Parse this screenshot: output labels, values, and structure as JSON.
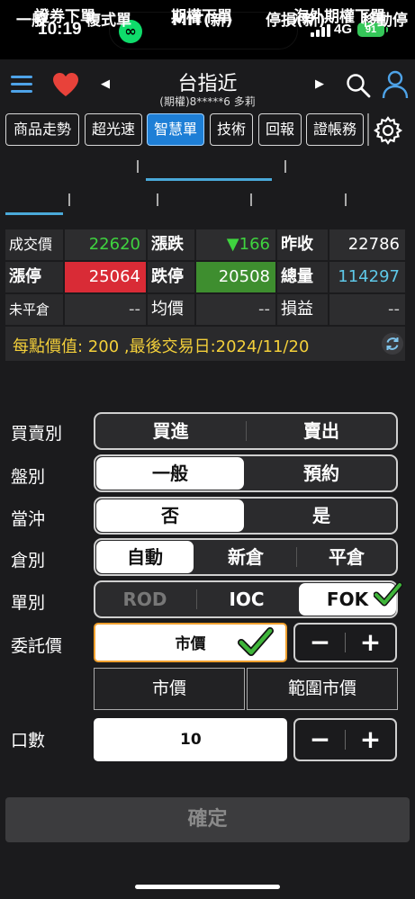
{
  "status_bar": {
    "time": "10:19",
    "network": "4G",
    "battery": "91"
  },
  "header": {
    "title": "台指近",
    "subtitle": "(期權)8*****6  多莉"
  },
  "func_buttons": [
    "商品走勢",
    "超光速",
    "智慧單",
    "技術",
    "回報",
    "證帳務"
  ],
  "tabs_primary": [
    "證券下單",
    "期權下單",
    "海外期權下單"
  ],
  "tabs_secondary": [
    "一般",
    "複式單",
    "MIT(新)",
    "停損(新)",
    "移動停"
  ],
  "quote": {
    "last_label": "成交價",
    "last_value": "22620",
    "change_label": "漲跌",
    "change_value": "▼166",
    "prev_close_label": "昨收",
    "prev_close_value": "22786",
    "limit_up_label": "漲停",
    "limit_up_value": "25064",
    "limit_down_label": "跌停",
    "limit_down_value": "20508",
    "volume_label": "總量",
    "volume_value": "114297",
    "open_pos_label": "未平倉",
    "open_pos_value": "--",
    "avg_label": "均價",
    "avg_value": "--",
    "pnl_label": "損益",
    "pnl_value": "--"
  },
  "info_bar": "每點價值: 200 ,最後交易日:2024/11/20",
  "form": {
    "side_label": "買賣別",
    "side_options": [
      "買進",
      "賣出"
    ],
    "session_label": "盤別",
    "session_options": [
      "一般",
      "預約"
    ],
    "daytrade_label": "當沖",
    "daytrade_options": [
      "否",
      "是"
    ],
    "position_label": "倉別",
    "position_options": [
      "自動",
      "新倉",
      "平倉"
    ],
    "order_type_label": "單別",
    "order_type_options": [
      "ROD",
      "IOC",
      "FOK"
    ],
    "price_label": "委託價",
    "price_value": "市價",
    "price_types": [
      "市價",
      "範圍市價"
    ],
    "qty_label": "口數",
    "qty_value": "10",
    "minus": "−",
    "plus": "+"
  },
  "confirm_label": "確定",
  "colors": {
    "accent": "#1e7fd6",
    "up": "#d92b36",
    "down": "#3e8e2f",
    "highlight": "#f3cf3a"
  }
}
